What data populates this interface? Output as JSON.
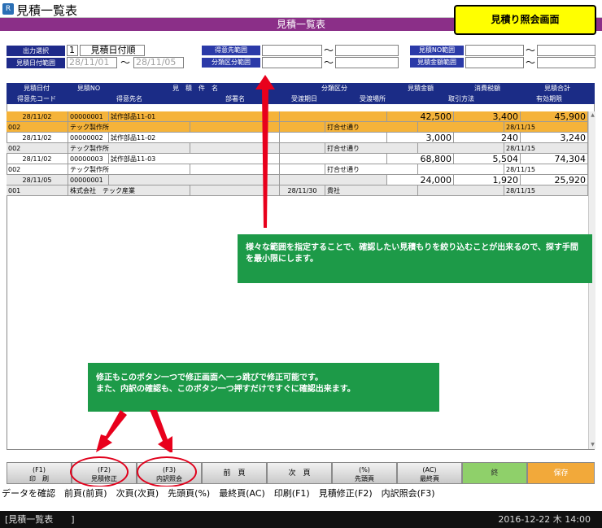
{
  "window": {
    "title": "見積一覧表",
    "header": "見積一覧表",
    "callout_top": "見積り照会画面"
  },
  "search": {
    "output_select_label": "出力選択",
    "output_select_value": "1",
    "output_select_text": "見積日付順",
    "date_range_label": "見積日付範囲",
    "date_from": "28/11/01",
    "date_to": "28/11/05",
    "customer_range_label": "得意先範囲",
    "category_range_label": "分類区分範囲",
    "estno_range_label": "見積NO範囲",
    "amount_range_label": "見積金額範囲",
    "tilde": "～"
  },
  "columns_row1": [
    "見積日付",
    "見積NO",
    "見　積　件　名",
    "分類区分",
    "見積金額",
    "消費税額",
    "見積合計"
  ],
  "columns_row2": [
    "得意先コード",
    "得意先名",
    "部署名",
    "受渡期日",
    "受渡場所",
    "取引方法",
    "有効期限"
  ],
  "records": [
    {
      "date": "28/11/02",
      "no": "00000001",
      "title": "試作部品11-01",
      "amount": "42,500",
      "tax": "3,400",
      "total": "45,900",
      "code": "002",
      "customer": "テック製作所",
      "place": "打合せ通り",
      "valid": "28/11/15",
      "delivery": ""
    },
    {
      "date": "28/11/02",
      "no": "00000002",
      "title": "試作部品11-02",
      "amount": "3,000",
      "tax": "240",
      "total": "3,240",
      "code": "002",
      "customer": "テック製作所",
      "place": "打合せ通り",
      "valid": "28/11/15",
      "delivery": ""
    },
    {
      "date": "28/11/02",
      "no": "00000003",
      "title": "試作部品11-03",
      "amount": "68,800",
      "tax": "5,504",
      "total": "74,304",
      "code": "002",
      "customer": "テック製作所",
      "place": "打合せ通り",
      "valid": "28/11/15",
      "delivery": ""
    },
    {
      "date": "28/11/05",
      "no": "00000001",
      "title": "",
      "amount": "24,000",
      "tax": "1,920",
      "total": "25,920",
      "code": "001",
      "customer": "株式会社　テック産業",
      "place": "貴社",
      "valid": "28/11/15",
      "delivery": "28/11/30"
    }
  ],
  "callouts": {
    "range": "様々な範囲を指定することで、確認したい見積もりを絞り込むことが出来るので、探す手間を最小限にします。",
    "button_line1": "修正もこのボタン一つで修正画面へ一っ跳びで修正可能です。",
    "button_line2": "また、内訳の確認も、このボタン一つ押すだけですぐに確認出来ます。"
  },
  "fkeys": [
    {
      "top": "(F1)",
      "bottom": "印　刷"
    },
    {
      "top": "(F2)",
      "bottom": "見積修正"
    },
    {
      "top": "(F3)",
      "bottom": "内訳照会"
    },
    {
      "top": "",
      "bottom": "前　頁"
    },
    {
      "top": "",
      "bottom": "次　頁"
    },
    {
      "top": "(%)",
      "bottom": "先頭頁"
    },
    {
      "top": "(AC)",
      "bottom": "最終頁"
    },
    {
      "top": "",
      "bottom": "終"
    },
    {
      "top": "",
      "bottom": "保存"
    }
  ],
  "status": {
    "hint": "データを確認　前頁(前頁)　次頁(次頁)　先頭頁(%)　最終頁(AC)　印刷(F1)　見積修正(F2)　内訳照会(F3)",
    "screen": "[見積一覧表　　]",
    "datetime": "2016-12-22 木 14:00"
  }
}
